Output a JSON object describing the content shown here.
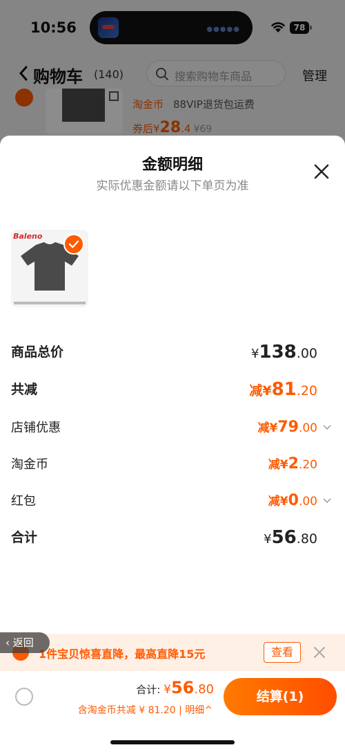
{
  "status": {
    "time": "10:56",
    "battery": "78"
  },
  "nav": {
    "title": "购物车",
    "count": "(140)",
    "search_placeholder": "搜索购物车商品",
    "manage": "管理"
  },
  "bg_item": {
    "coin_tag": "淘金币",
    "vip_tag": "88VIP退货包运费",
    "price_label": "券后¥",
    "price_int": "28",
    "price_dec": ".4",
    "orig_price": "¥69"
  },
  "sheet": {
    "title": "金额明细",
    "subtitle": "实际优惠金额请以下单页为准",
    "brand": "Baleno"
  },
  "rows": {
    "goods_total": {
      "label": "商品总价",
      "sym": "¥",
      "int": "138",
      "dec": ".00"
    },
    "total_reduce": {
      "label": "共减",
      "prefix": "减¥",
      "int": "81",
      "dec": ".20"
    },
    "shop_discount": {
      "label": "店铺优惠",
      "prefix": "减¥",
      "int": "79",
      "dec": ".00"
    },
    "taojinbi": {
      "label": "淘金币",
      "prefix": "减¥",
      "int": "2",
      "dec": ".20"
    },
    "red_packet": {
      "label": "红包",
      "prefix": "减¥",
      "int": "0",
      "dec": ".00"
    },
    "sum": {
      "label": "合计",
      "sym": "¥",
      "int": "56",
      "dec": ".80"
    }
  },
  "promo": {
    "text": "1件宝贝惊喜直降，最高直降15元",
    "button": "查看",
    "return": "返回"
  },
  "bottom": {
    "total_label": "合计: ",
    "sym": "¥",
    "int": "56",
    "dec": ".80",
    "saving": "含淘金币共减 ¥ 81.20 | 明细^",
    "checkout": "结算(1)"
  },
  "colors": {
    "accent": "#ff5a00"
  }
}
